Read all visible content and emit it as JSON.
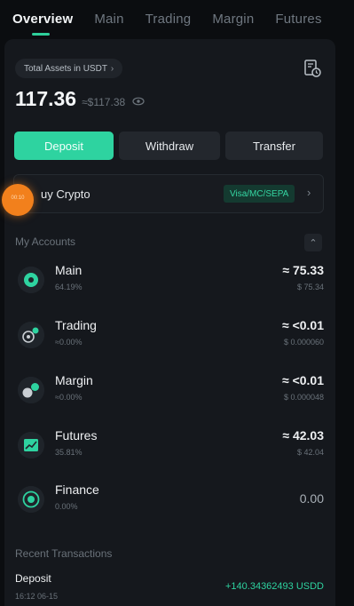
{
  "tabs": [
    {
      "label": "Overview",
      "active": true
    },
    {
      "label": "Main"
    },
    {
      "label": "Trading"
    },
    {
      "label": "Margin"
    },
    {
      "label": "Futures"
    }
  ],
  "summary": {
    "label": "Total Assets in USDT",
    "chevron": "›",
    "amount": "117.36",
    "approx": "≈$117.38"
  },
  "actions": {
    "deposit": "Deposit",
    "withdraw": "Withdraw",
    "transfer": "Transfer"
  },
  "buy_crypto": {
    "label": "uy Crypto",
    "methods": "Visa/MC/SEPA",
    "chevron": "›"
  },
  "touch_indicator_label": "00:10",
  "my_accounts": {
    "title": "My Accounts",
    "collapse": "⌃",
    "items": [
      {
        "name": "Main",
        "pct": "64.19%",
        "amount": "≈ 75.33",
        "usd": "$ 75.34",
        "icon": "main-wallet-icon"
      },
      {
        "name": "Trading",
        "pct": "≈0.00%",
        "amount": "≈ <0.01",
        "usd": "$ 0.000060",
        "icon": "trading-icon"
      },
      {
        "name": "Margin",
        "pct": "≈0.00%",
        "amount": "≈ <0.01",
        "usd": "$ 0.000048",
        "icon": "margin-icon"
      },
      {
        "name": "Futures",
        "pct": "35.81%",
        "amount": "≈ 42.03",
        "usd": "$ 42.04",
        "icon": "futures-chart-icon"
      },
      {
        "name": "Finance",
        "pct": "0.00%",
        "amount": "0.00",
        "usd": "",
        "icon": "finance-icon"
      }
    ]
  },
  "recent": {
    "title": "Recent Transactions",
    "items": [
      {
        "type": "Deposit",
        "time": "16:12 06-15",
        "amount": "+140.34362493 USDD"
      }
    ]
  },
  "colors": {
    "accent": "#2ed3a0",
    "background": "#0b0d10",
    "panel": "#15181d",
    "touch_indicator": "#f2801c"
  }
}
